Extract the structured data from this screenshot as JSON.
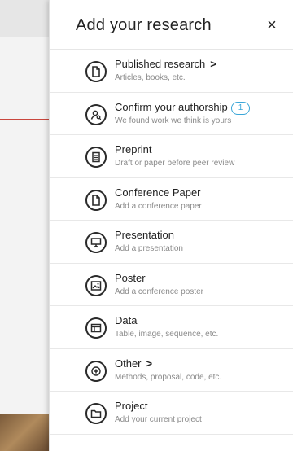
{
  "panel": {
    "title": "Add your research",
    "close_label": "×"
  },
  "items": [
    {
      "label": "Published research",
      "sub": "Articles, books, etc.",
      "chevron": ">",
      "icon": "document-icon"
    },
    {
      "label": "Confirm your authorship",
      "sub": "We found work we think is yours",
      "badge": "1",
      "icon": "person-search-icon"
    },
    {
      "label": "Preprint",
      "sub": "Draft or paper before peer review",
      "icon": "preprint-icon"
    },
    {
      "label": "Conference Paper",
      "sub": "Add a conference paper",
      "icon": "document-icon"
    },
    {
      "label": "Presentation",
      "sub": "Add a presentation",
      "icon": "presentation-icon"
    },
    {
      "label": "Poster",
      "sub": "Add a conference poster",
      "icon": "poster-icon"
    },
    {
      "label": "Data",
      "sub": "Table, image, sequence, etc.",
      "icon": "data-table-icon"
    },
    {
      "label": "Other",
      "sub": "Methods, proposal, code, etc.",
      "chevron": ">",
      "icon": "plus-icon"
    },
    {
      "label": "Project",
      "sub": "Add your current project",
      "icon": "folder-icon"
    }
  ],
  "colors": {
    "badge": "#3aa6d8",
    "accent_line": "#c9463d"
  }
}
